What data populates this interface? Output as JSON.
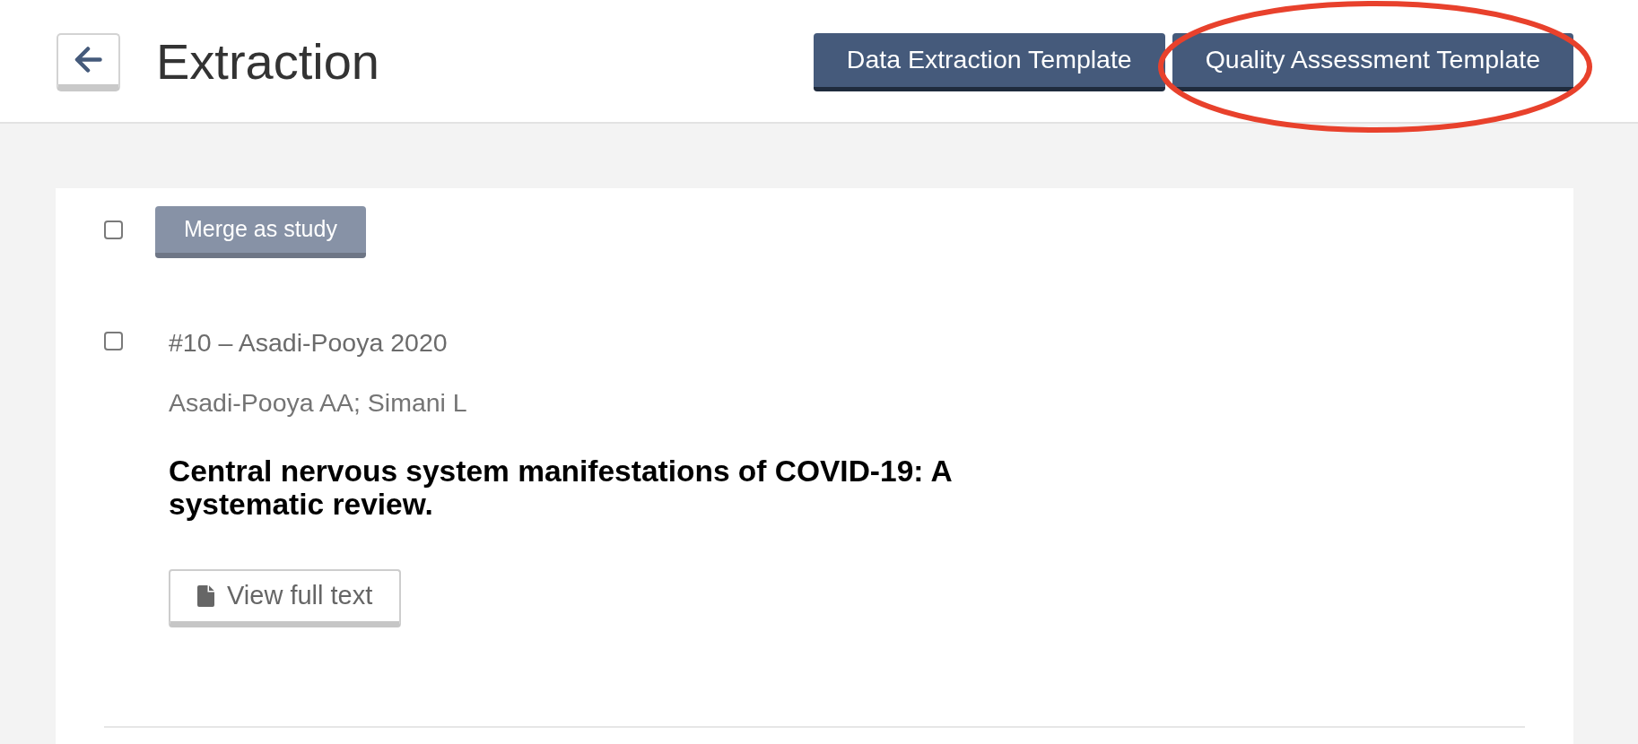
{
  "header": {
    "title": "Extraction",
    "buttons": [
      {
        "label": "Data Extraction Template",
        "highlighted": false
      },
      {
        "label": "Quality Assessment Template",
        "highlighted": true
      }
    ]
  },
  "toolbar": {
    "select_all": {
      "checked": false
    },
    "merge_button": {
      "label": "Merge as study",
      "disabled": true
    }
  },
  "studies": [
    {
      "checked": false,
      "heading": "#10 – Asadi-Pooya 2020",
      "authors": "Asadi-Pooya AA; Simani L",
      "title": "Central nervous system manifestations of COVID-19: A systematic review.",
      "full_text_button": "View full text"
    }
  ]
}
